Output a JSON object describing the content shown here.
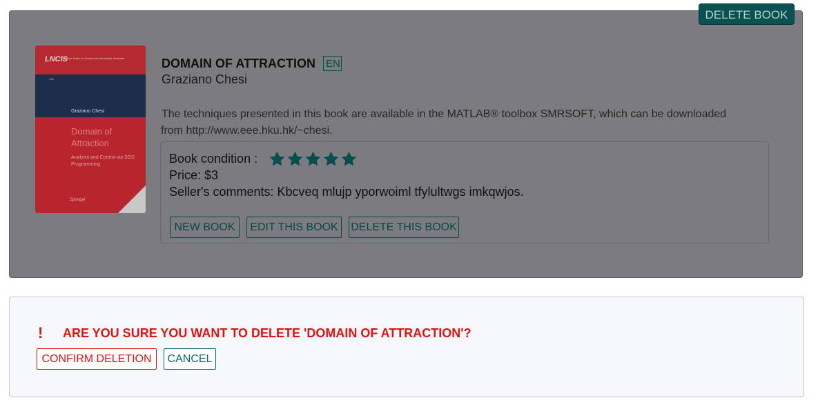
{
  "header": {
    "delete_book_label": "DELETE BOOK"
  },
  "book": {
    "title": "DOMAIN OF ATTRACTION",
    "language": "EN",
    "author": "Graziano Chesi",
    "description": "The techniques presented in this book are available in the MATLAB® toolbox SMRSOFT, which can be downloaded from http://www.eee.hku.hk/~chesi.",
    "condition_label": "Book condition :",
    "condition_stars": 5,
    "condition_max": 5,
    "price": "Price: $3",
    "comments": "Seller's comments: Kbcveq mlujp yporwoiml tfylultwgs imkqwjos."
  },
  "cover": {
    "series": "LNCIS",
    "series_subtitle": "Lecture Notes in Control and Information Sciences",
    "number": "416",
    "author": "Graziano Chesi",
    "title": "Domain of Attraction",
    "subtitle": "Analysis and Control via SOS Programming",
    "publisher": "Springer"
  },
  "actions": {
    "new_book": "NEW BOOK",
    "edit_book": "EDIT THIS BOOK",
    "delete_book": "DELETE THIS BOOK"
  },
  "confirm": {
    "icon": "exclamation-icon",
    "question": "ARE YOU SURE YOU WANT TO DELETE 'DOMAIN OF ATTRACTION'?",
    "confirm_label": "CONFIRM DELETION",
    "cancel_label": "CANCEL"
  },
  "colors": {
    "accent": "#074848",
    "danger": "#e01212",
    "overlay": "#7c7c80",
    "star": "#074f4f"
  }
}
